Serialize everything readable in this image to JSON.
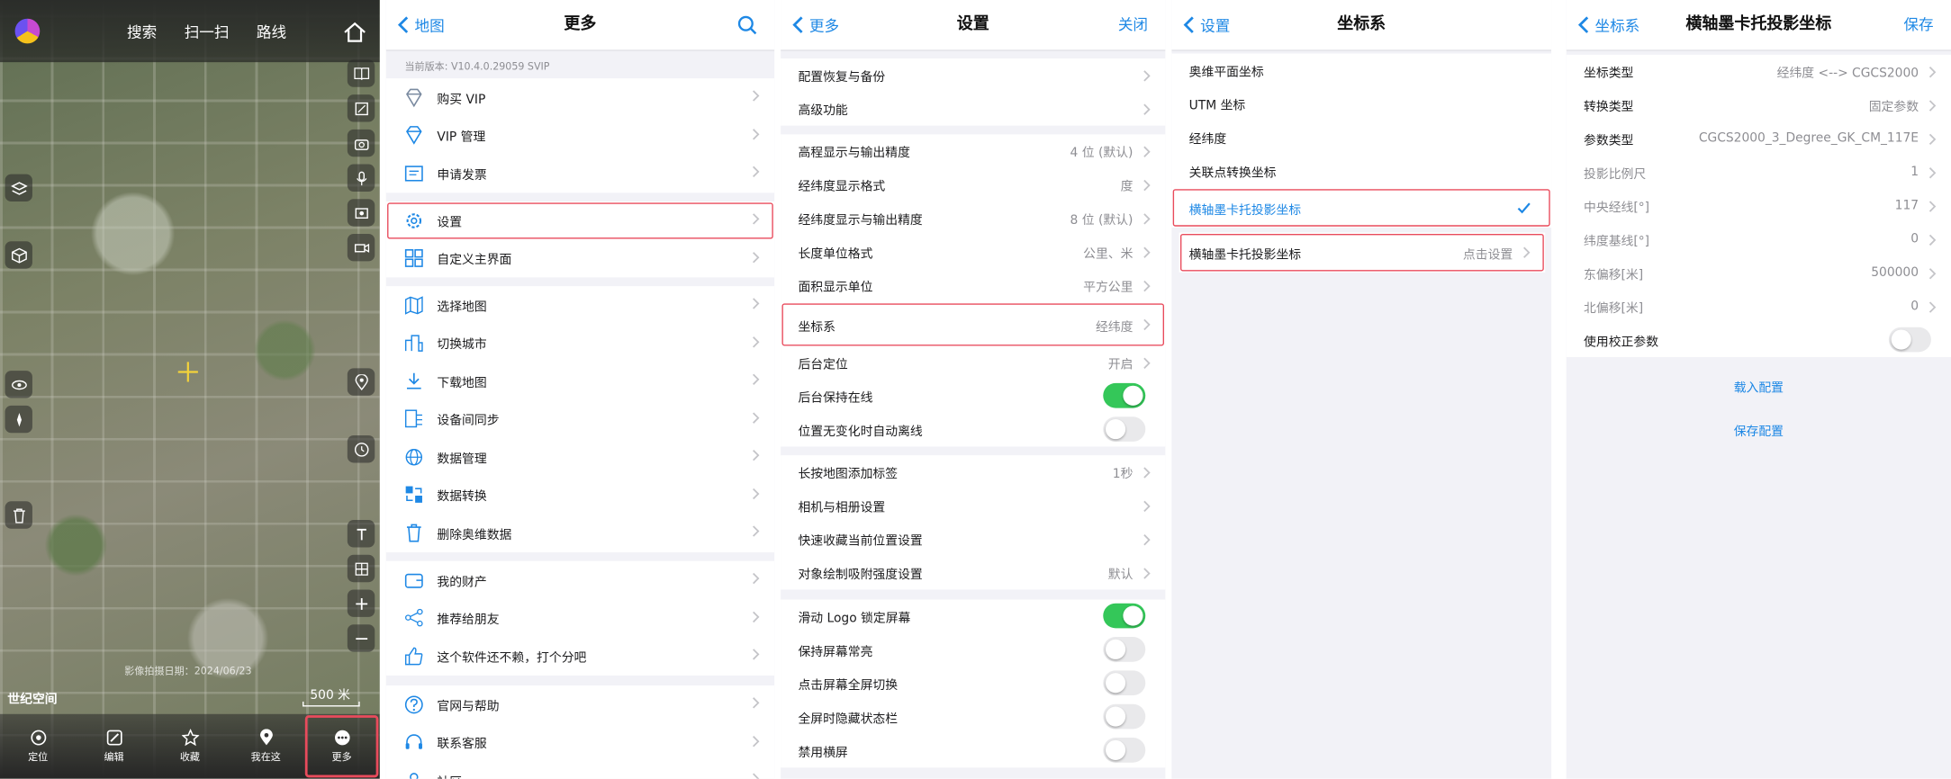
{
  "map": {
    "top_links": [
      "搜索",
      "扫一扫",
      "路线"
    ],
    "watermark": "影像拍摄日期：2024/06/23",
    "brand": "世纪空间",
    "scale": "500 米",
    "bottom_tabs": [
      "定位",
      "编辑",
      "收藏",
      "我在这",
      "更多"
    ]
  },
  "more": {
    "back": "地图",
    "title": "更多",
    "version": "当前版本: V10.4.0.29059 SVIP",
    "groups": [
      [
        "购买 VIP",
        "VIP 管理",
        "申请发票"
      ],
      [
        "设置",
        "自定义主界面"
      ],
      [
        "选择地图",
        "切换城市",
        "下载地图",
        "设备间同步",
        "数据管理",
        "数据转换",
        "删除奥维数据"
      ],
      [
        "我的财产",
        "推荐给朋友",
        "这个软件还不赖，打个分吧"
      ],
      [
        "官网与帮助",
        "联系客服",
        "社区"
      ]
    ]
  },
  "settings": {
    "back": "更多",
    "title": "设置",
    "close": "关闭",
    "groups": [
      [
        {
          "label": "配置恢复与备份",
          "value": ""
        },
        {
          "label": "高级功能",
          "value": ""
        }
      ],
      [
        {
          "label": "高程显示与输出精度",
          "value": "4 位 (默认)"
        },
        {
          "label": "经纬度显示格式",
          "value": "度"
        },
        {
          "label": "经纬度显示与输出精度",
          "value": "8 位 (默认)"
        },
        {
          "label": "长度单位格式",
          "value": "公里、米"
        },
        {
          "label": "面积显示单位",
          "value": "平方公里"
        },
        {
          "label": "坐标系",
          "value": "经纬度"
        }
      ],
      [
        {
          "label": "后台定位",
          "value": "开启"
        },
        {
          "label": "后台保持在线",
          "toggle": true
        },
        {
          "label": "位置无变化时自动离线",
          "toggle": false
        }
      ],
      [
        {
          "label": "长按地图添加标签",
          "value": "1秒"
        },
        {
          "label": "相机与相册设置",
          "value": ""
        },
        {
          "label": "快速收藏当前位置设置",
          "value": ""
        },
        {
          "label": "对象绘制吸附强度设置",
          "value": "默认"
        }
      ],
      [
        {
          "label": "滑动 Logo 锁定屏幕",
          "toggle": true
        },
        {
          "label": "保持屏幕常亮",
          "toggle": false
        },
        {
          "label": "点击屏幕全屏切换",
          "toggle": false
        },
        {
          "label": "全屏时隐藏状态栏",
          "toggle": false
        },
        {
          "label": "禁用横屏",
          "toggle": false
        }
      ]
    ]
  },
  "coords": {
    "back": "设置",
    "title": "坐标系",
    "items": [
      "奥维平面坐标",
      "UTM 坐标",
      "经纬度",
      "关联点转换坐标",
      "横轴墨卡托投影坐标"
    ],
    "selected_index": 4,
    "config_label": "横轴墨卡托投影坐标",
    "config_value": "点击设置"
  },
  "tm": {
    "back": "坐标系",
    "title": "横轴墨卡托投影坐标",
    "save": "保存",
    "rows": [
      {
        "label": "坐标类型",
        "value": "经纬度 <--> CGCS2000",
        "dim": false
      },
      {
        "label": "转换类型",
        "value": "固定参数",
        "dim": false
      },
      {
        "label": "参数类型",
        "value": "CGCS2000_3_Degree_GK_CM_117E",
        "dim": false
      },
      {
        "label": "投影比例尺",
        "value": "1",
        "dim": true
      },
      {
        "label": "中央经线[°]",
        "value": "117",
        "dim": true
      },
      {
        "label": "纬度基线[°]",
        "value": "0",
        "dim": true
      },
      {
        "label": "东偏移[米]",
        "value": "500000",
        "dim": true
      },
      {
        "label": "北偏移[米]",
        "value": "0",
        "dim": true
      }
    ],
    "toggle_label": "使用校正参数",
    "toggle_on": false,
    "load": "载入配置",
    "save_config": "保存配置"
  }
}
